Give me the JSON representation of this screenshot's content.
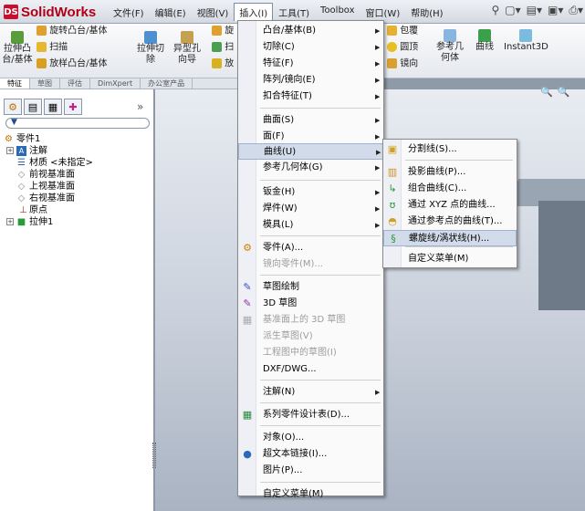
{
  "app": {
    "logo_mark": "DS",
    "logo_text": "SolidWorks"
  },
  "menubar": [
    "文件(F)",
    "编辑(E)",
    "视图(V)",
    "插入(I)",
    "工具(T)",
    "Toolbox",
    "窗口(W)",
    "帮助(H)"
  ],
  "ribbon": {
    "extrude_boss": "拉伸凸\n台/基体",
    "revolve_boss": "旋转凸台/基体",
    "sweep": "扫描",
    "loft": "放样凸台/基体",
    "extrude_cut": "拉伸切\n除",
    "hole_wizard": "异型孔\n向导",
    "rev_short": "旋",
    "sweep_short": "扫",
    "loft_short": "放",
    "wrap": "包覆",
    "dome": "圆顶",
    "mirror": "镜向",
    "ref_geom": "参考几\n何体",
    "curves": "曲线",
    "instant3d": "Instant3D"
  },
  "command_tabs": [
    "特征",
    "草图",
    "评估",
    "DimXpert",
    "办公室产品"
  ],
  "tree": {
    "root": "零件1",
    "items": [
      "注解",
      "材质 <未指定>",
      "前视基准面",
      "上视基准面",
      "右视基准面",
      "原点",
      "拉伸1"
    ]
  },
  "insert_menu": {
    "items": [
      {
        "label": "凸台/基体(B)",
        "sub": true
      },
      {
        "label": "切除(C)",
        "sub": true
      },
      {
        "label": "特征(F)",
        "sub": true
      },
      {
        "label": "阵列/镜向(E)",
        "sub": true
      },
      {
        "label": "扣合特征(T)",
        "sub": true
      },
      {
        "label": "曲面(S)",
        "sub": true
      },
      {
        "label": "面(F)",
        "sub": true
      },
      {
        "label": "曲线(U)",
        "sub": true
      },
      {
        "label": "参考几何体(G)",
        "sub": true
      },
      {
        "label": "钣金(H)",
        "sub": true
      },
      {
        "label": "焊件(W)",
        "sub": true
      },
      {
        "label": "模具(L)",
        "sub": true
      },
      {
        "label": "零件(A)..."
      },
      {
        "label": "镜向零件(M)..."
      },
      {
        "label": "草图绘制"
      },
      {
        "label": "3D 草图"
      },
      {
        "label": "基准面上的 3D 草图"
      },
      {
        "label": "派生草图(V)"
      },
      {
        "label": "工程图中的草图(I)"
      },
      {
        "label": "DXF/DWG..."
      },
      {
        "label": "注解(N)",
        "sub": true
      },
      {
        "label": "系列零件设计表(D)..."
      },
      {
        "label": "对象(O)..."
      },
      {
        "label": "超文本链接(I)..."
      },
      {
        "label": "图片(P)..."
      },
      {
        "label": "自定义菜单(M)"
      }
    ]
  },
  "curve_menu": {
    "items": [
      {
        "label": "分割线(S)..."
      },
      {
        "label": "投影曲线(P)..."
      },
      {
        "label": "组合曲线(C)..."
      },
      {
        "label": "通过 XYZ 点的曲线..."
      },
      {
        "label": "通过参考点的曲线(T)..."
      },
      {
        "label": "螺旋线/涡状线(H)..."
      },
      {
        "label": "自定义菜单(M)"
      }
    ]
  },
  "colors": {
    "accent_red": "#c8102e",
    "highlight": "#d2dbe9",
    "menu_bg": "#fafafa"
  },
  "icons": [
    "search-icon",
    "zoom-icon",
    "new-doc-icon",
    "open-icon",
    "save-icon",
    "print-icon",
    "filter-icon"
  ]
}
